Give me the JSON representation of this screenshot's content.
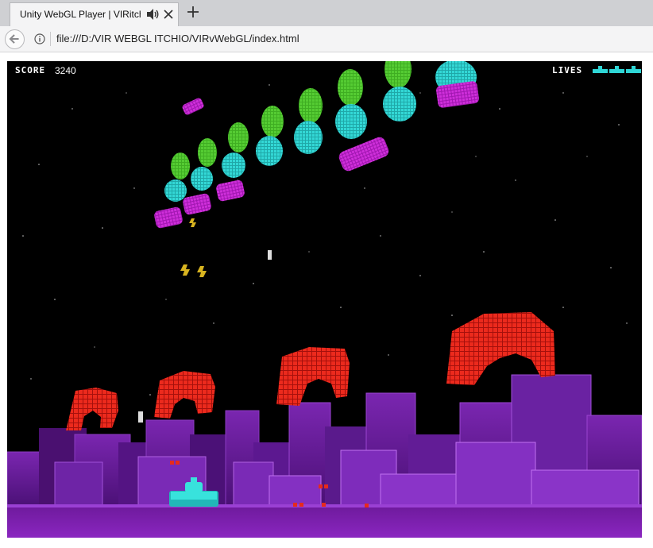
{
  "browser": {
    "tab_title": "Unity WebGL Player | VIRitch",
    "url": "file:///D:/VIR WEBGL ITCHIO/VIRvWebGL/index.html",
    "icons": [
      "speaker-icon",
      "close-icon",
      "plus-icon",
      "back-arrow-icon",
      "info-icon"
    ]
  },
  "hud": {
    "score_label": "SCORE",
    "score_value": "3240",
    "lives_label": "LIVES",
    "lives_count": 3
  },
  "colors": {
    "invader_top": "#3fae22",
    "invader_mid": "#2fd0cf",
    "invader_bottom": "#c21fce",
    "shield": "#e8231b",
    "ground": "#6a1a96",
    "player": "#2fe0d6",
    "lives": "#2fd6d6"
  }
}
